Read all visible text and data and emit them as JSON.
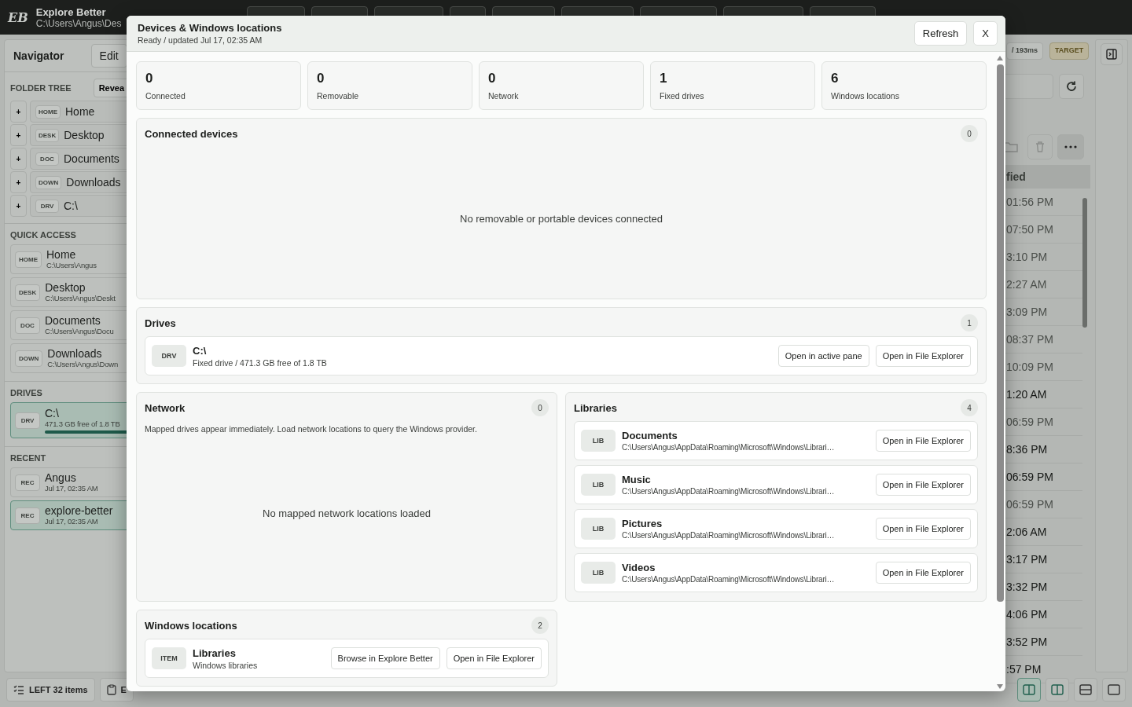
{
  "app": {
    "logo": "EB",
    "title": "Explore Better",
    "path": "C:\\Users\\Angus\\Des"
  },
  "navigator": {
    "title": "Navigator",
    "edit": "Edit",
    "folder_tree": {
      "heading": "FOLDER TREE",
      "reveal": "Revea",
      "items": [
        {
          "expander": "+",
          "badge": "HOME",
          "label": "Home"
        },
        {
          "expander": "+",
          "badge": "DESK",
          "label": "Desktop"
        },
        {
          "expander": "+",
          "badge": "DOC",
          "label": "Documents"
        },
        {
          "expander": "+",
          "badge": "DOWN",
          "label": "Downloads"
        },
        {
          "expander": "+",
          "badge": "DRV",
          "label": "C:\\"
        }
      ]
    },
    "quick_access": {
      "heading": "QUICK ACCESS",
      "items": [
        {
          "badge": "HOME",
          "label": "Home",
          "path": "C:\\Users\\Angus"
        },
        {
          "badge": "DESK",
          "label": "Desktop",
          "path": "C:\\Users\\Angus\\Deskt"
        },
        {
          "badge": "DOC",
          "label": "Documents",
          "path": "C:\\Users\\Angus\\Docu"
        },
        {
          "badge": "DOWN",
          "label": "Downloads",
          "path": "C:\\Users\\Angus\\Down"
        }
      ]
    },
    "drives": {
      "heading": "DRIVES",
      "items": [
        {
          "badge": "DRV",
          "label": "C:\\",
          "detail": "471.3 GB free of 1.8 TB",
          "level": 0.74,
          "selected": true
        }
      ]
    },
    "recent": {
      "heading": "RECENT",
      "items": [
        {
          "badge": "REC",
          "label": "Angus",
          "time": "Jul 17, 02:35 AM",
          "selected": false
        },
        {
          "badge": "REC",
          "label": "explore-better",
          "time": "Jul 17, 02:35 AM",
          "selected": true
        }
      ]
    }
  },
  "right_pane": {
    "status_chip": "/ 193ms",
    "target": "TARGET",
    "column_header": "fied",
    "rows": [
      {
        "time": "01:56 PM",
        "bold": false
      },
      {
        "time": "07:50 PM",
        "bold": false
      },
      {
        "time": "3:10 PM",
        "bold": false
      },
      {
        "time": "2:27 AM",
        "bold": false
      },
      {
        "time": "3:09 PM",
        "bold": false
      },
      {
        "time": "08:37 PM",
        "bold": false
      },
      {
        "time": "10:09 PM",
        "bold": false
      },
      {
        "time": "1:20 AM",
        "bold": true
      },
      {
        "time": "06:59 PM",
        "bold": false
      },
      {
        "time": "8:36 PM",
        "bold": true
      },
      {
        "time": "06:59 PM",
        "bold": true
      },
      {
        "time": "06:59 PM",
        "bold": false
      },
      {
        "time": "2:06 AM",
        "bold": true
      },
      {
        "time": "3:17 PM",
        "bold": true
      },
      {
        "time": "3:32 PM",
        "bold": true
      },
      {
        "time": "4:06 PM",
        "bold": true
      },
      {
        "time": "3:52 PM",
        "bold": true
      },
      {
        "time": ":57 PM",
        "bold": true
      }
    ]
  },
  "status_bar": {
    "pane": "LEFT 32 items",
    "button": "E"
  },
  "modal": {
    "title": "Devices & Windows locations",
    "status": "Ready / updated Jul 17, 02:35 AM",
    "refresh": "Refresh",
    "close": "X",
    "stats": [
      {
        "value": "0",
        "label": "Connected"
      },
      {
        "value": "0",
        "label": "Removable"
      },
      {
        "value": "0",
        "label": "Network"
      },
      {
        "value": "1",
        "label": "Fixed drives"
      },
      {
        "value": "6",
        "label": "Windows locations"
      }
    ],
    "connected": {
      "title": "Connected devices",
      "count": "0",
      "empty": "No removable or portable devices connected"
    },
    "drives": {
      "title": "Drives",
      "count": "1",
      "items": [
        {
          "badge": "DRV",
          "name": "C:\\",
          "detail": "Fixed drive / 471.3 GB free of 1.8 TB",
          "actions": [
            "Open in active pane",
            "Open in File Explorer"
          ]
        }
      ]
    },
    "network": {
      "title": "Network",
      "count": "0",
      "note": "Mapped drives appear immediately. Load network locations to query the Windows provider.",
      "empty": "No mapped network locations loaded"
    },
    "libraries": {
      "title": "Libraries",
      "count": "4",
      "items": [
        {
          "badge": "LIB",
          "name": "Documents",
          "detail": "C:\\Users\\Angus\\AppData\\Roaming\\Microsoft\\Windows\\Librari…",
          "actions": [
            "Open in File Explorer"
          ]
        },
        {
          "badge": "LIB",
          "name": "Music",
          "detail": "C:\\Users\\Angus\\AppData\\Roaming\\Microsoft\\Windows\\Librari…",
          "actions": [
            "Open in File Explorer"
          ]
        },
        {
          "badge": "LIB",
          "name": "Pictures",
          "detail": "C:\\Users\\Angus\\AppData\\Roaming\\Microsoft\\Windows\\Librari…",
          "actions": [
            "Open in File Explorer"
          ]
        },
        {
          "badge": "LIB",
          "name": "Videos",
          "detail": "C:\\Users\\Angus\\AppData\\Roaming\\Microsoft\\Windows\\Librari…",
          "actions": [
            "Open in File Explorer"
          ]
        }
      ]
    },
    "windows_locations": {
      "title": "Windows locations",
      "count": "2",
      "items": [
        {
          "badge": "ITEM",
          "name": "Libraries",
          "detail": "Windows libraries",
          "actions": [
            "Browse in Explore Better",
            "Open in File Explorer"
          ]
        }
      ]
    }
  }
}
